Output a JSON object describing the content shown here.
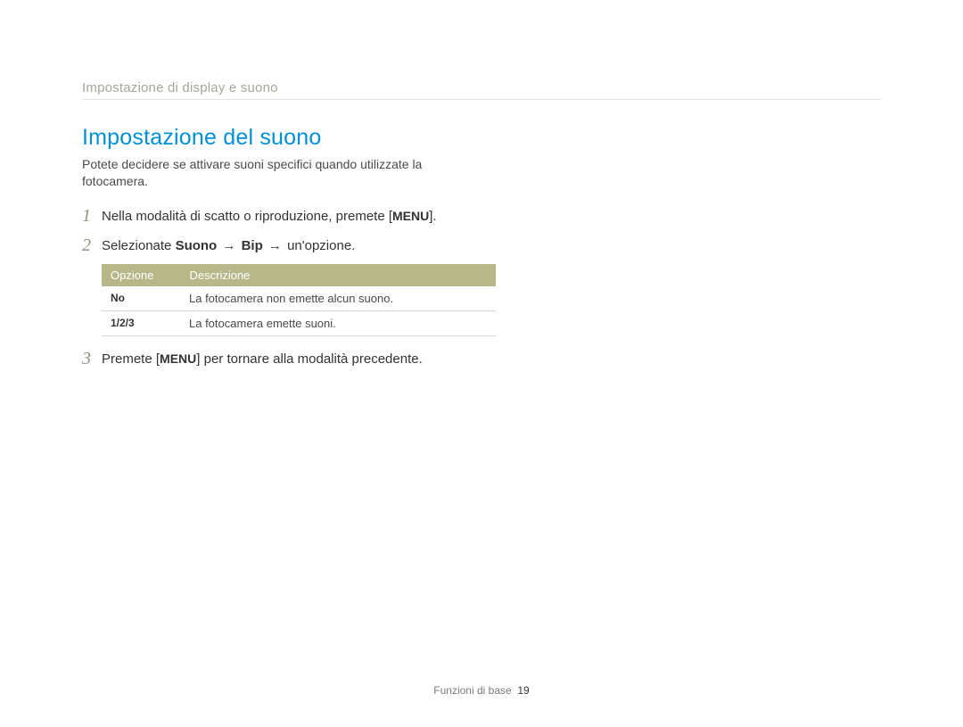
{
  "breadcrumb": "Impostazione di display e suono",
  "heading": "Impostazione del suono",
  "intro": "Potete decidere se attivare suoni specifici quando utilizzate la fotocamera.",
  "steps": {
    "s1": {
      "num": "1",
      "pre": "Nella modalità di scatto o riproduzione, premete [",
      "kbd": "MENU",
      "post": "]."
    },
    "s2": {
      "num": "2",
      "pre": "Selezionate ",
      "b1": "Suono",
      "arrow1": "→",
      "b2": "Bip",
      "arrow2": "→",
      "post": " un'opzione."
    },
    "s3": {
      "num": "3",
      "pre": "Premete [",
      "kbd": "MENU",
      "post": "] per tornare alla modalità precedente."
    }
  },
  "table": {
    "header": {
      "col1": "Opzione",
      "col2": "Descrizione"
    },
    "rows": [
      {
        "opt": "No",
        "desc": "La fotocamera non emette alcun suono."
      },
      {
        "opt": "1/2/3",
        "desc": "La fotocamera emette suoni."
      }
    ]
  },
  "footer": {
    "section": "Funzioni di base",
    "page": "19"
  }
}
